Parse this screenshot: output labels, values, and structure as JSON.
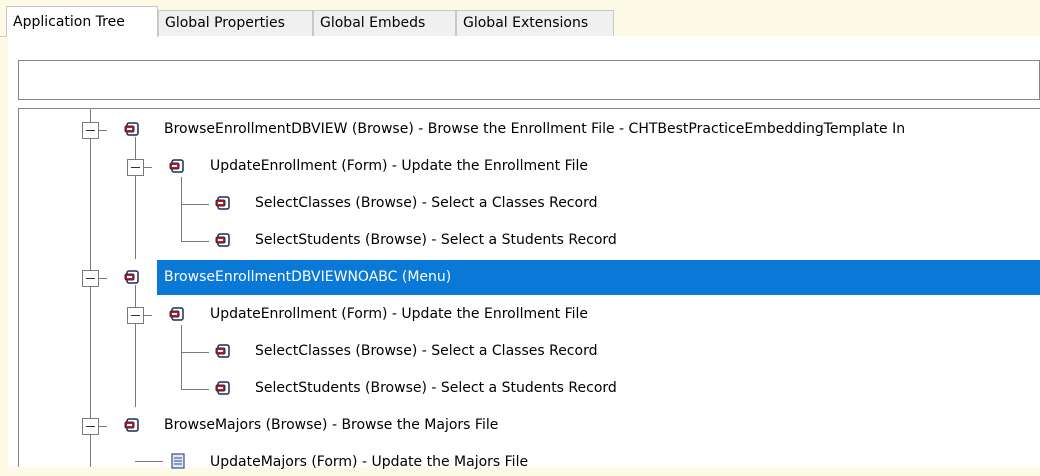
{
  "tabs": [
    {
      "label": "Application Tree",
      "active": true
    },
    {
      "label": "Global Properties",
      "active": false
    },
    {
      "label": "Global Embeds",
      "active": false
    },
    {
      "label": "Global Extensions",
      "active": false
    }
  ],
  "filter": {
    "value": ""
  },
  "tree": {
    "rows": [
      {
        "label": "BrowseEnrollmentDBVIEW (Browse) - Browse the Enrollment File -  CHTBestPracticeEmbeddingTemplate In",
        "icon": "procedure-icon"
      },
      {
        "label": "UpdateEnrollment (Form) - Update the Enrollment File",
        "icon": "procedure-icon"
      },
      {
        "label": "SelectClasses (Browse) - Select a Classes Record",
        "icon": "procedure-icon"
      },
      {
        "label": "SelectStudents (Browse) - Select a Students Record",
        "icon": "procedure-icon"
      },
      {
        "label": "BrowseEnrollmentDBVIEWNOABC (Menu)",
        "icon": "procedure-icon",
        "selected": true
      },
      {
        "label": "UpdateEnrollment (Form) - Update the Enrollment File",
        "icon": "procedure-icon"
      },
      {
        "label": "SelectClasses (Browse) - Select a Classes Record",
        "icon": "procedure-icon"
      },
      {
        "label": "SelectStudents (Browse) - Select a Students Record",
        "icon": "procedure-icon"
      },
      {
        "label": "BrowseMajors (Browse) - Browse the Majors File",
        "icon": "procedure-icon"
      },
      {
        "label": "UpdateMajors (Form) - Update the Majors File",
        "icon": "document-icon"
      }
    ]
  },
  "colors": {
    "selection": "#0a78d7",
    "background": "#fdfbe6"
  }
}
